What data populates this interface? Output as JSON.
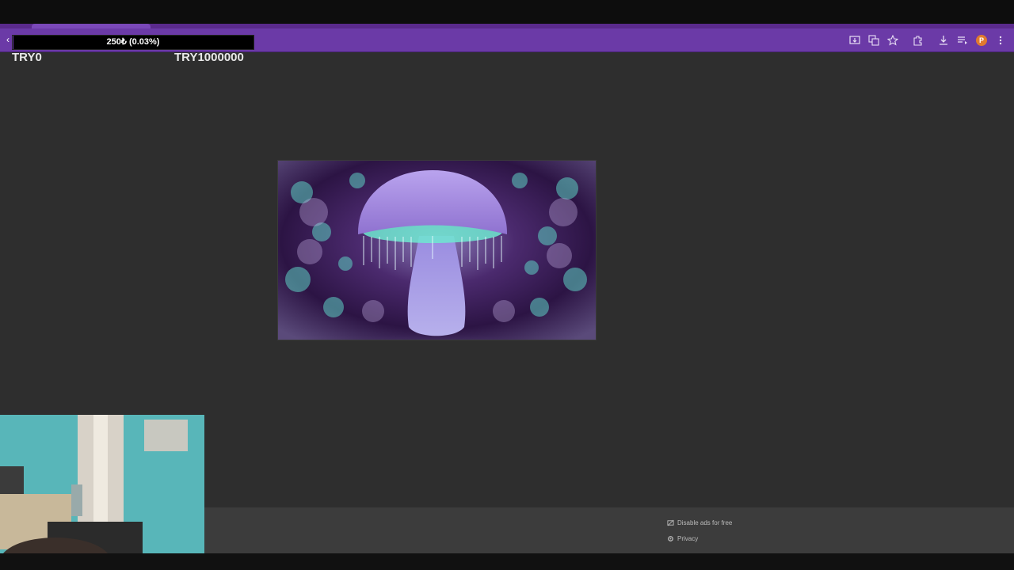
{
  "progress": {
    "text": "250₺ (0.03%)",
    "fraction": 0.0003
  },
  "labels": {
    "left": "TRY0",
    "right": "TRY1000000"
  },
  "profile": {
    "initial": "P"
  },
  "toolbar_icons": [
    "install-app-icon",
    "translate-icon",
    "bookmark-star-icon",
    "extensions-icon",
    "download-icon",
    "media-control-icon",
    "profile-avatar",
    "more-menu-icon"
  ],
  "footer": {
    "disable_ads": "Disable ads for free",
    "privacy": "Privacy"
  },
  "colors": {
    "accent": "#6b3aa7",
    "background": "#2e2e2e",
    "mushroom": "#a48be0",
    "glow": "#6ee8d0"
  }
}
